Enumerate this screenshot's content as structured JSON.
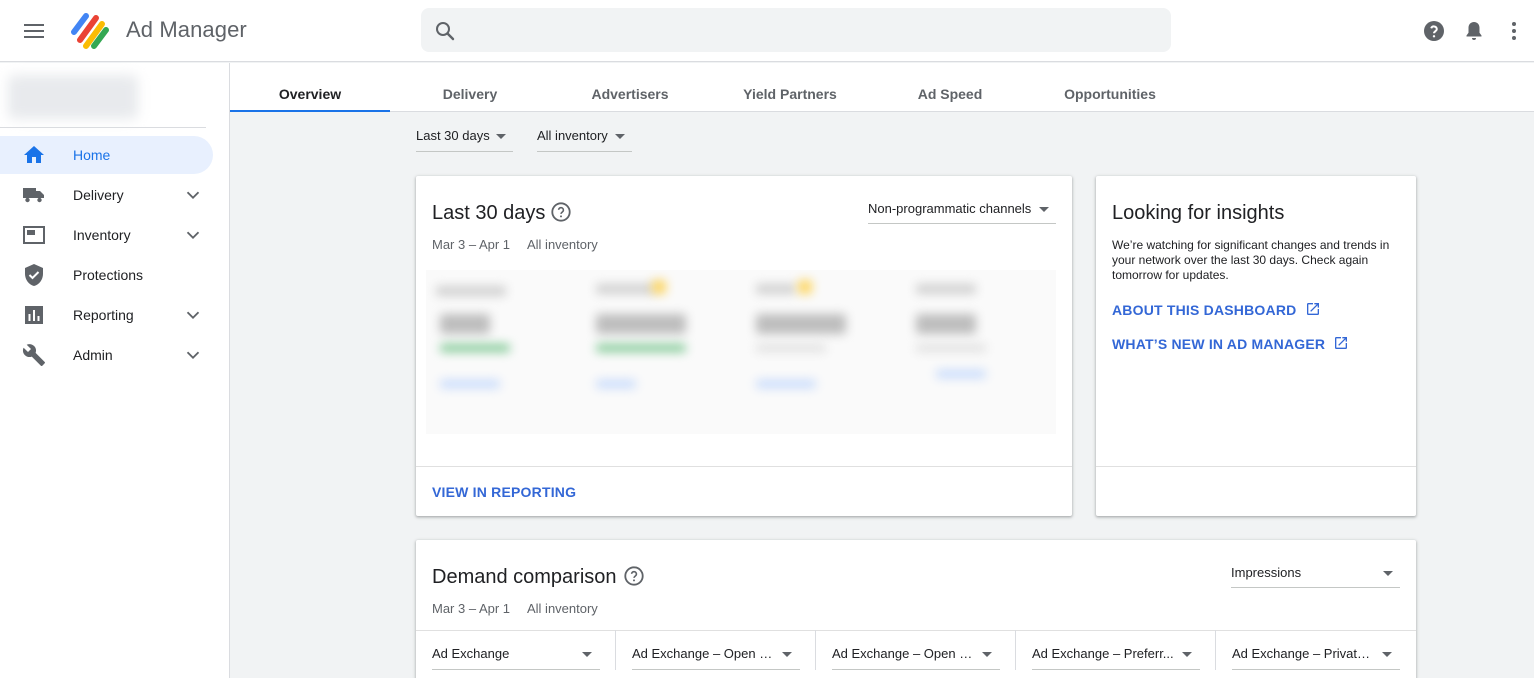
{
  "app": {
    "title": "Ad Manager"
  },
  "search": {
    "placeholder": "",
    "value": ""
  },
  "sidebar": {
    "items": [
      {
        "label": "Home",
        "icon": "home-icon",
        "active": true,
        "expandable": false
      },
      {
        "label": "Delivery",
        "icon": "truck-icon",
        "active": false,
        "expandable": true
      },
      {
        "label": "Inventory",
        "icon": "inventory-icon",
        "active": false,
        "expandable": true
      },
      {
        "label": "Protections",
        "icon": "shield-icon",
        "active": false,
        "expandable": false
      },
      {
        "label": "Reporting",
        "icon": "bar-chart-icon",
        "active": false,
        "expandable": true
      },
      {
        "label": "Admin",
        "icon": "wrench-icon",
        "active": false,
        "expandable": true
      }
    ]
  },
  "tabs": [
    {
      "label": "Overview",
      "active": true
    },
    {
      "label": "Delivery",
      "active": false
    },
    {
      "label": "Advertisers",
      "active": false
    },
    {
      "label": "Yield Partners",
      "active": false
    },
    {
      "label": "Ad Speed",
      "active": false
    },
    {
      "label": "Opportunities",
      "active": false
    }
  ],
  "filters": {
    "date_range": "Last 30 days",
    "inventory": "All inventory"
  },
  "summary_card": {
    "title": "Last 30 days",
    "channel_select": "Non-programmatic channels",
    "date_range": "Mar 3 – Apr 1",
    "inventory": "All inventory",
    "link": "VIEW IN REPORTING"
  },
  "insights_card": {
    "title": "Looking for insights",
    "body": "We’re watching for significant changes and trends in your network over the last 30 days. Check again tomorrow for updates.",
    "links": [
      {
        "label": "ABOUT THIS DASHBOARD"
      },
      {
        "label": "WHAT’S NEW IN AD MANAGER"
      }
    ]
  },
  "demand_card": {
    "title": "Demand comparison",
    "metric_select": "Impressions",
    "date_range": "Mar 3 – Apr 1",
    "inventory": "All inventory",
    "filters": [
      {
        "label": "Ad Exchange"
      },
      {
        "label": "Ad Exchange – Open a..."
      },
      {
        "label": "Ad Exchange – Open a..."
      },
      {
        "label": "Ad Exchange – Preferr..."
      },
      {
        "label": "Ad Exchange – Private ..."
      }
    ]
  },
  "colors": {
    "accent": "#1a73e8",
    "link": "#3367d6",
    "active_bg": "#e8f0fe"
  }
}
